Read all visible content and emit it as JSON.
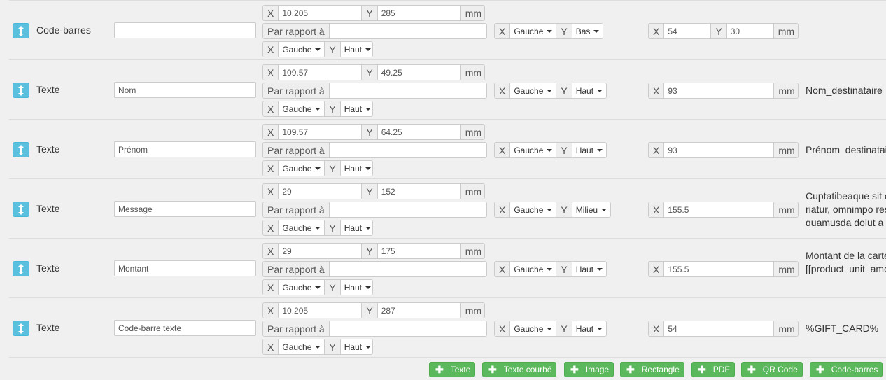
{
  "labels": {
    "x": "X",
    "y": "Y",
    "unit": "mm",
    "relative_to": "Par rapport à"
  },
  "rows": [
    {
      "type": "Code-barres",
      "name": "",
      "x": "10.205",
      "y": "285",
      "rel": "",
      "anchor_x": "Gauche",
      "anchor_y": "Haut",
      "rel_anchor_x": "Gauche",
      "rel_anchor_y": "Bas",
      "w": "54",
      "h": "30",
      "note": ""
    },
    {
      "type": "Texte",
      "name": "Nom",
      "x": "109.57",
      "y": "49.25",
      "rel": "",
      "anchor_x": "Gauche",
      "anchor_y": "Haut",
      "rel_anchor_x": "Gauche",
      "rel_anchor_y": "Haut",
      "w": "93",
      "note": "Nom_destinataire"
    },
    {
      "type": "Texte",
      "name": "Prénom",
      "x": "109.57",
      "y": "64.25",
      "rel": "",
      "anchor_x": "Gauche",
      "anchor_y": "Haut",
      "rel_anchor_x": "Gauche",
      "rel_anchor_y": "Haut",
      "w": "93",
      "note": "Prénom_destinatai"
    },
    {
      "type": "Texte",
      "name": "Message",
      "x": "29",
      "y": "152",
      "rel": "",
      "anchor_x": "Gauche",
      "anchor_y": "Haut",
      "rel_anchor_x": "Gauche",
      "rel_anchor_y": "Milieu",
      "w": "155.5",
      "note_lines": [
        "Cuptatibeaque sit c",
        "riatur, omnimpo res",
        "quamusda dolut a"
      ]
    },
    {
      "type": "Texte",
      "name": "Montant",
      "x": "29",
      "y": "175",
      "rel": "",
      "anchor_x": "Gauche",
      "anchor_y": "Haut",
      "rel_anchor_x": "Gauche",
      "rel_anchor_y": "Haut",
      "w": "155.5",
      "note_lines": [
        "Montant de la carte",
        "[[product_unit_amo"
      ]
    },
    {
      "type": "Texte",
      "name": "Code-barre texte",
      "x": "10.205",
      "y": "287",
      "rel": "",
      "anchor_x": "Gauche",
      "anchor_y": "Haut",
      "rel_anchor_x": "Gauche",
      "rel_anchor_y": "Haut",
      "w": "54",
      "note": "%GIFT_CARD%"
    }
  ],
  "buttons": [
    {
      "label": "Texte"
    },
    {
      "label": "Texte courbé"
    },
    {
      "label": "Image"
    },
    {
      "label": "Rectangle"
    },
    {
      "label": "PDF"
    },
    {
      "label": "QR Code"
    },
    {
      "label": "Code-barres"
    }
  ],
  "colors": {
    "info": "#5bc0de",
    "success": "#5cb85c",
    "background": "#f0f0f0"
  },
  "icons": {
    "handle": "vertical-arrows-icon",
    "add": "plus-icon"
  }
}
